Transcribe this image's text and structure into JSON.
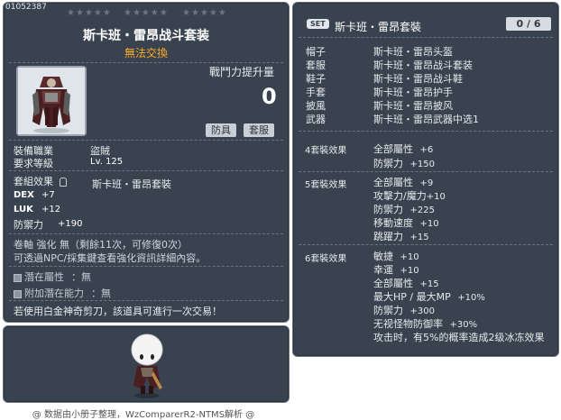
{
  "item": {
    "code": "01052387",
    "stars": [
      "★★★★★",
      "★★★★★",
      "★★★★★"
    ],
    "name": "斯卡班・雷昂战斗套装",
    "trade": "無法交換",
    "power_label": "戰鬥力提升量",
    "power_value": "0",
    "tags": [
      "防具",
      "套服"
    ],
    "job_label": "裝備職業",
    "job_value": "盜賊",
    "req_label": "要求等級",
    "req_value": "Lv. 125",
    "set_effect_label": "套組效果",
    "set_effect_name": "斯卡班・雷昂套裝",
    "stats": [
      {
        "name": "DEX",
        "value": "+7"
      },
      {
        "name": "LUK",
        "value": "+12"
      },
      {
        "name": "防禦力",
        "value": "+190"
      }
    ],
    "scroll_line": "卷軸 強化 無（剩餘11次，可修復0次）",
    "npc_line": "可透過NPC/採集鍵查看強化資訊詳細內容。",
    "potential_label": "潛在屬性",
    "potential_value": "：無",
    "extra_potential_label": "附加潛在能力",
    "extra_potential_value": "：無",
    "scissors_note": "若使用白金神奇剪刀，該道具可進行一次交易！"
  },
  "set": {
    "badge": "SET",
    "title": "斯卡班・雷昂套裝",
    "counter": "0 / 6",
    "pieces": [
      {
        "slot": "帽子",
        "name": "斯卡班・雷昂头盔"
      },
      {
        "slot": "套服",
        "name": "斯卡班・雷昂战斗套装"
      },
      {
        "slot": "鞋子",
        "name": "斯卡班・雷昂战斗鞋"
      },
      {
        "slot": "手套",
        "name": "斯卡班・雷昂护手"
      },
      {
        "slot": "披風",
        "name": "斯卡班・雷昂披风"
      },
      {
        "slot": "武器",
        "name": "斯卡班・雷昂武器中选1"
      }
    ],
    "effects": [
      {
        "label": "4套裝效果",
        "lines": [
          {
            "text": "全部屬性",
            "val": "+6"
          },
          {
            "text": "防禦力",
            "val": "+150"
          }
        ]
      },
      {
        "label": "5套裝效果",
        "lines": [
          {
            "text": "全部屬性",
            "val": "+9"
          },
          {
            "text": "攻擊力/魔力",
            "val": "+10"
          },
          {
            "text": "防禦力",
            "val": "+225"
          },
          {
            "text": "移動速度",
            "val": "+10"
          },
          {
            "text": "跳躍力",
            "val": "+15"
          }
        ]
      },
      {
        "label": "6套裝效果",
        "lines": [
          {
            "text": "敏捷",
            "val": "+10"
          },
          {
            "text": "幸運",
            "val": "+10"
          },
          {
            "text": "全部屬性",
            "val": "+15"
          },
          {
            "text": "最大HP / 最大MP",
            "val": "+10%"
          },
          {
            "text": "防禦力",
            "val": "+300"
          },
          {
            "text": "无视怪物防御率",
            "val": "+30%"
          },
          {
            "text": "攻击时，有5%的概率造成2级冰冻效果",
            "val": ""
          }
        ]
      }
    ]
  },
  "footer": "@ 数据由小册子整理，WzComparerR2-NTMS解析 @",
  "colors": {
    "panel": "#39434f",
    "trade": "#ffaa22",
    "border": "#6b7380"
  },
  "icons": [
    "armor-item-icon",
    "checkbox-icon",
    "set-badge-icon",
    "character-avatar-icon"
  ]
}
